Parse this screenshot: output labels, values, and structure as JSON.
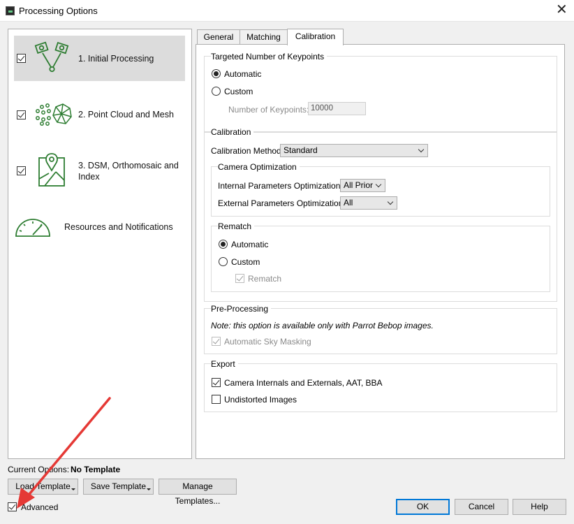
{
  "window": {
    "title": "Processing Options",
    "close_symbol": "✕"
  },
  "sidebar": {
    "items": [
      {
        "label": "1. Initial Processing",
        "checked": true,
        "icon": "initial-processing-icon"
      },
      {
        "label": "2. Point Cloud and Mesh",
        "checked": true,
        "icon": "point-cloud-icon"
      },
      {
        "label_line1": "3. DSM, Orthomosaic and",
        "label_line2": "Index",
        "checked": true,
        "icon": "map-icon"
      },
      {
        "label": "Resources and Notifications",
        "icon": "gauge-icon"
      }
    ]
  },
  "tabs": [
    {
      "label": "General"
    },
    {
      "label": "Matching"
    },
    {
      "label": "Calibration",
      "active": true
    }
  ],
  "keypoints": {
    "title": "Targeted Number of Keypoints",
    "automatic_label": "Automatic",
    "custom_label": "Custom",
    "number_label": "Number of Keypoints:",
    "number_value": "10000"
  },
  "calibration": {
    "title": "Calibration",
    "method_label": "Calibration Method",
    "method_value": "Standard",
    "camera_opt_title": "Camera Optimization",
    "internal_label": "Internal Parameters Optimization:",
    "internal_value": "All Prior",
    "external_label": "External Parameters Optimization:",
    "external_value": "All",
    "rematch_title": "Rematch",
    "rematch_automatic": "Automatic",
    "rematch_custom": "Custom",
    "rematch_checkbox": "Rematch"
  },
  "preprocessing": {
    "title": "Pre-Processing",
    "note": "Note: this option is available only with Parrot Bebop images.",
    "sky_masking": "Automatic Sky Masking"
  },
  "export": {
    "title": "Export",
    "camera_internals": "Camera Internals and Externals, AAT, BBA",
    "undistorted": "Undistorted Images"
  },
  "footer": {
    "current_options_label": "Current Options:",
    "current_options_value": "No Template",
    "load_template": "Load Template",
    "save_template": "Save Template",
    "manage_templates": "Manage Templates...",
    "advanced": "Advanced",
    "ok": "OK",
    "cancel": "Cancel",
    "help": "Help"
  },
  "colors": {
    "icon_green": "#2e7d32",
    "annotation_arrow": "#e53935",
    "focus_blue": "#0078d7"
  }
}
